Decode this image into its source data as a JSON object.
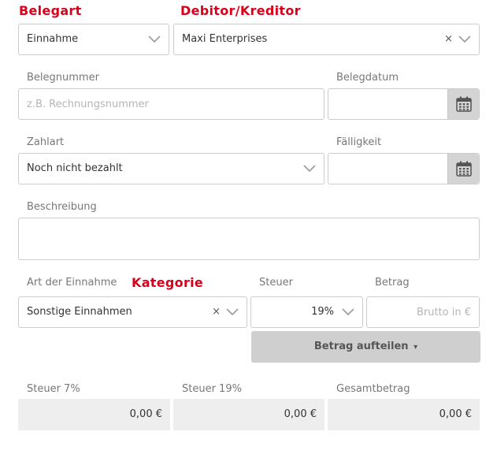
{
  "annotations": {
    "belegart": "Belegart",
    "debitor": "Debitor/Kreditor",
    "kategorie": "Kategorie"
  },
  "belegart_select": {
    "value": "Einnahme"
  },
  "debitor_select": {
    "value": "Maxi Enterprises",
    "clear": "×"
  },
  "belegnummer": {
    "label": "Belegnummer",
    "placeholder": "z.B. Rechnungsnummer"
  },
  "belegdatum": {
    "label": "Belegdatum",
    "value": ""
  },
  "zahlart": {
    "label": "Zahlart",
    "value": "Noch nicht bezahlt"
  },
  "faelligkeit": {
    "label": "Fälligkeit",
    "value": ""
  },
  "beschreibung": {
    "label": "Beschreibung",
    "value": ""
  },
  "art": {
    "label": "Art der Einnahme",
    "value": "Sonstige Einnahmen",
    "clear": "×"
  },
  "steuer": {
    "label": "Steuer",
    "value": "19%"
  },
  "betrag": {
    "label": "Betrag",
    "placeholder": "Brutto in €"
  },
  "split_button": {
    "label": "Betrag aufteilen",
    "caret": "▾"
  },
  "totals": [
    {
      "label": "Steuer 7%",
      "value": "0,00 €"
    },
    {
      "label": "Steuer 19%",
      "value": "0,00 €"
    },
    {
      "label": "Gesamtbetrag",
      "value": "0,00 €"
    }
  ],
  "colors": {
    "annotation_red": "#d9001b",
    "border": "#cccccc",
    "readonly_bg": "#eeeeee",
    "button_bg": "#cfcfcf"
  },
  "icons": {
    "chevron": "chevron-down-icon",
    "calendar": "calendar-icon",
    "clear": "clear-icon"
  }
}
